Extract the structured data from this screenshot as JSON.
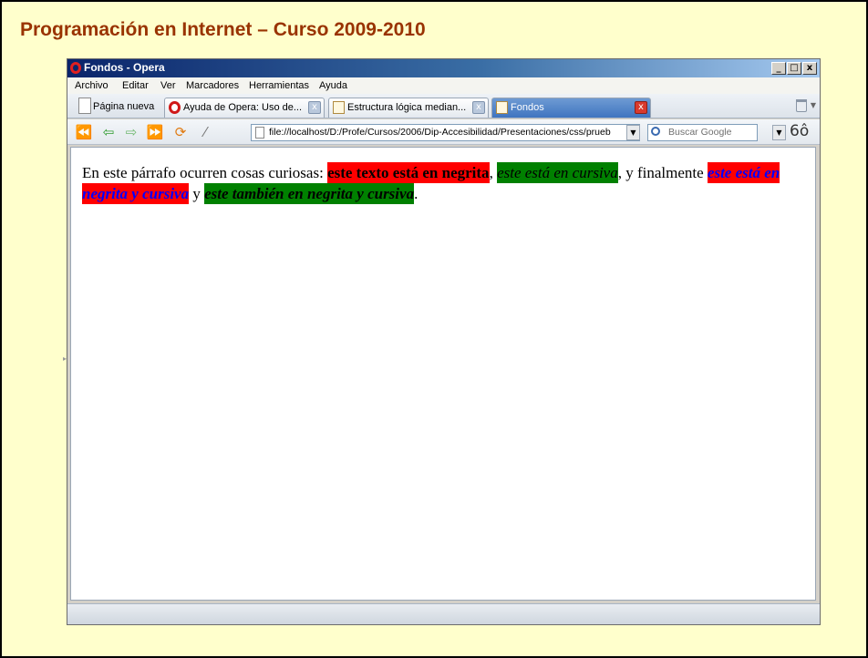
{
  "slide": {
    "title": "Programación en Internet – Curso 2009-2010",
    "background": "#ffffcc",
    "title_color": "#993300"
  },
  "window": {
    "title": "Fondos - Opera",
    "controls": {
      "minimize": "_",
      "maximize": "□",
      "close": "x"
    }
  },
  "menu": {
    "items": [
      "Archivo",
      "Editar",
      "Ver",
      "Marcadores",
      "Herramientas",
      "Ayuda"
    ]
  },
  "tabs": {
    "new_page": "Página nueva",
    "items": [
      {
        "label": "Ayuda de Opera: Uso de...",
        "icon": "opera-icon"
      },
      {
        "label": "Estructura lógica median...",
        "icon": "document-icon"
      },
      {
        "label": "Fondos",
        "icon": "document-icon",
        "active": true
      }
    ],
    "close_glyph": "x"
  },
  "navbar": {
    "address": "file://localhost/D:/Profe/Cursos/2006/Dip-Accesibilidad/Presentaciones/css/prueb",
    "search_placeholder": "Buscar Google",
    "icons": [
      "rewind-icon",
      "back-icon",
      "forward-icon",
      "fast-forward-icon",
      "reload-icon",
      "edit-icon",
      "search-icon",
      "glasses-icon"
    ]
  },
  "page": {
    "intro": "En este párrafo ocurren cosas curiosas: ",
    "bold_red": "este texto está en negrita",
    "sep1": ", ",
    "italic_green": "este está en cursiva",
    "sep2": ", y finalmente ",
    "bold_italic_red": "este está en negrita y cursiva",
    "sep3": " y ",
    "bold_italic_green": "este también en negrita y cursiva",
    "end": "."
  },
  "colors": {
    "highlight_red": "#ff0000",
    "highlight_green": "#008000",
    "link_blue": "#0000ff"
  }
}
